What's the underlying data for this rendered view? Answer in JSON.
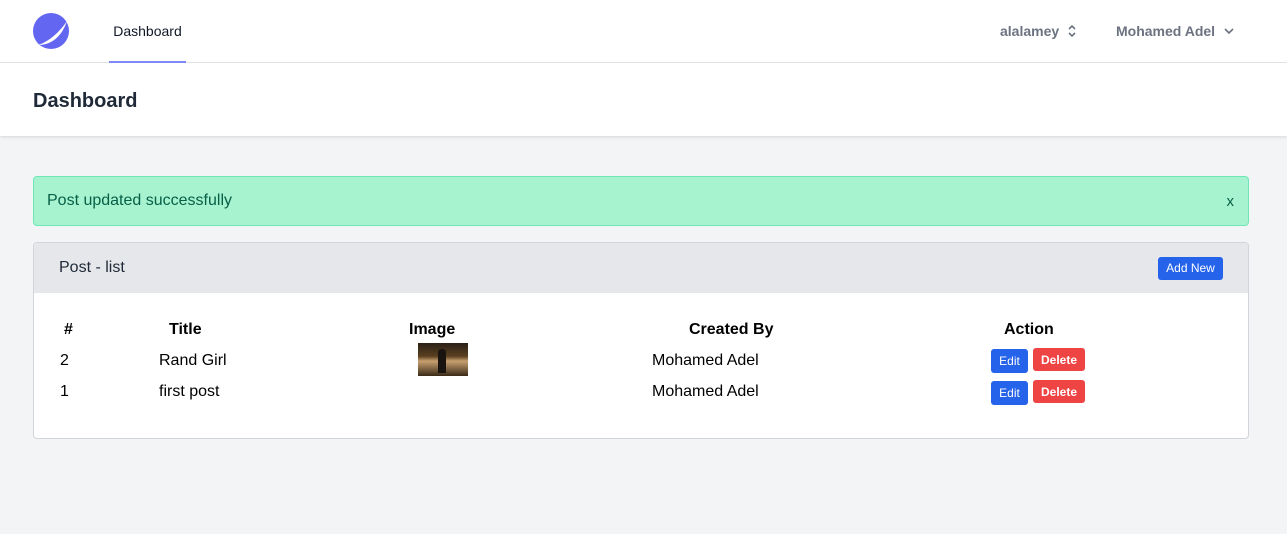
{
  "nav": {
    "link": "Dashboard",
    "team": "alalamey",
    "user": "Mohamed Adel"
  },
  "header": {
    "title": "Dashboard"
  },
  "alert": {
    "message": "Post updated successfully",
    "close": "x"
  },
  "card": {
    "title": "Post - list",
    "add_label": "Add New",
    "columns": [
      "#",
      "Title",
      "Image",
      "Created By",
      "Action"
    ],
    "rows": [
      {
        "id": "2",
        "title": "Rand Girl",
        "has_image": true,
        "created_by": "Mohamed Adel",
        "edit": "Edit",
        "delete": "Delete"
      },
      {
        "id": "1",
        "title": "first post",
        "has_image": false,
        "created_by": "Mohamed Adel",
        "edit": "Edit",
        "delete": "Delete"
      }
    ]
  },
  "colors": {
    "accent": "#818cf8",
    "success_bg": "#a7f3d0",
    "button_blue": "#2563eb",
    "button_red": "#ef4444"
  }
}
